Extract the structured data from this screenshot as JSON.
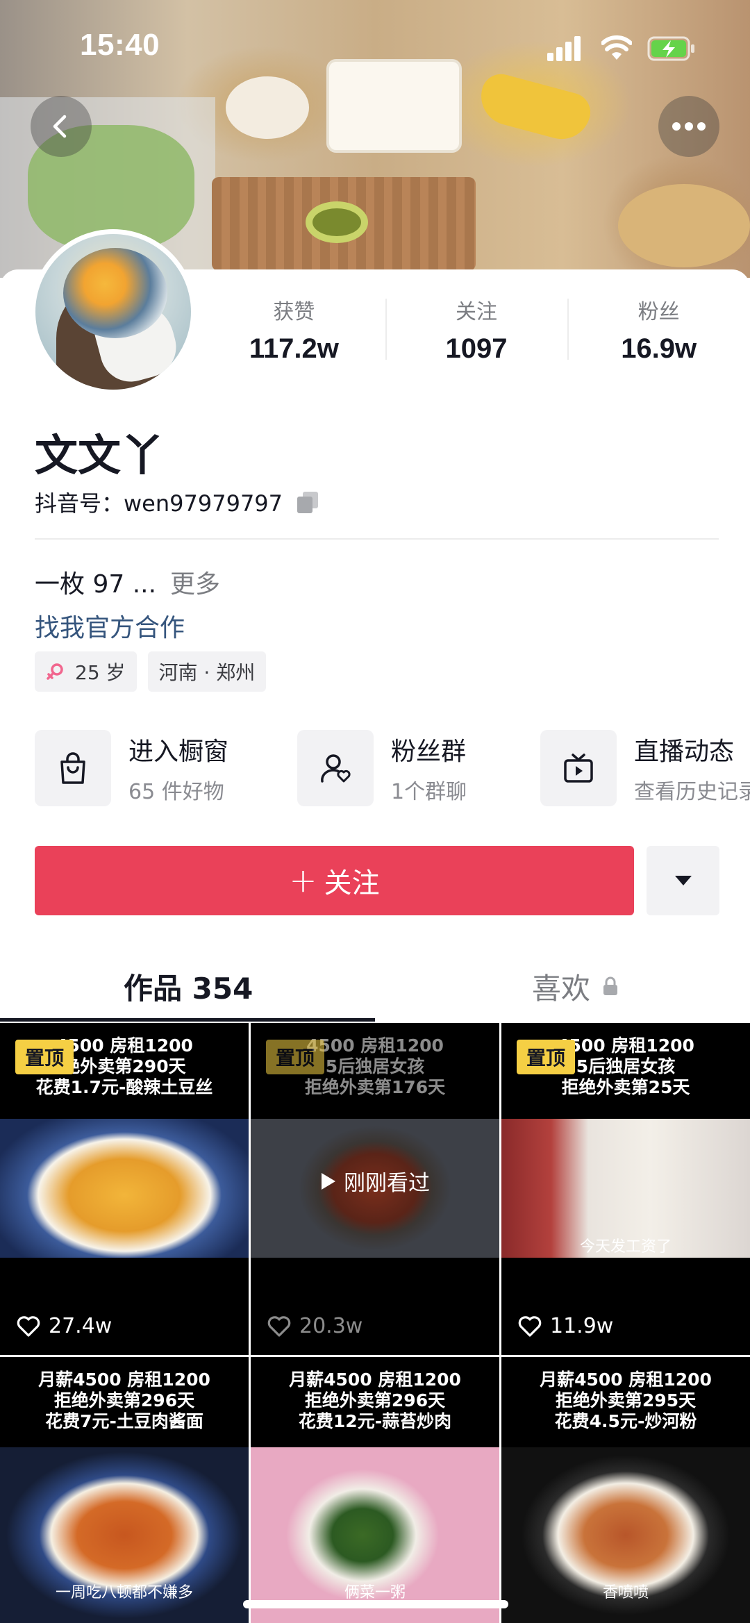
{
  "status_bar": {
    "time": "15:40"
  },
  "colors": {
    "follow": "#ea4159",
    "link": "#35557d",
    "pin": "#f5cf44"
  },
  "icons": {
    "back": "chevron-left-icon",
    "more": "ellipsis-icon",
    "copy": "copy-icon",
    "shop": "shopping-bag-icon",
    "fans": "user-heart-icon",
    "live": "tv-play-icon",
    "dropdown": "caret-down-icon",
    "lock": "lock-icon",
    "like": "heart-icon",
    "play": "play-icon"
  },
  "profile": {
    "stats": [
      {
        "label": "获赞",
        "value": "117.2w"
      },
      {
        "label": "关注",
        "value": "1097"
      },
      {
        "label": "粉丝",
        "value": "16.9w"
      }
    ],
    "name": "文文丫",
    "douyin_id": "抖音号：wen97979797",
    "bio": "一枚 97 ...",
    "bio_more": "更多",
    "biz_link": "找我官方合作",
    "tags": {
      "age": "25 岁",
      "location": "河南 · 郑州"
    }
  },
  "features": [
    {
      "title": "进入橱窗",
      "subtitle": "65 件好物"
    },
    {
      "title": "粉丝群",
      "subtitle": "1个群聊"
    },
    {
      "title": "直播动态",
      "subtitle": "查看历史记录"
    }
  ],
  "actions": {
    "follow_label": "关注",
    "follow_plus": "+"
  },
  "tabs": {
    "works": "作品 354",
    "likes": "喜欢"
  },
  "videos": [
    {
      "caption_lines": [
        "4500 房租1200",
        "绝外卖第290天",
        "花费1.7元-酸辣土豆丝"
      ],
      "pinned": "置顶",
      "likes": "27.4w"
    },
    {
      "caption_lines": [
        "4500 房租1200",
        "5后独居女孩",
        "拒绝外卖第176天"
      ],
      "pinned": "置顶",
      "likes": "20.3w",
      "overlay": "刚刚看过"
    },
    {
      "caption_lines": [
        "4500 房租1200",
        "5后独居女孩",
        "拒绝外卖第25天"
      ],
      "pinned": "置顶",
      "likes": "11.9w",
      "subtitle": "今天发工资了"
    },
    {
      "caption_lines": [
        "月薪4500 房租1200",
        "拒绝外卖第296天",
        "花费7元-土豆肉酱面"
      ],
      "subtitle": "一周吃八顿都不嫌多"
    },
    {
      "caption_lines": [
        "月薪4500 房租1200",
        "拒绝外卖第296天",
        "花费12元-蒜苔炒肉"
      ],
      "subtitle": "俩菜一粥"
    },
    {
      "caption_lines": [
        "月薪4500 房租1200",
        "拒绝外卖第295天",
        "花费4.5元-炒河粉"
      ],
      "subtitle": "香喷喷"
    }
  ]
}
